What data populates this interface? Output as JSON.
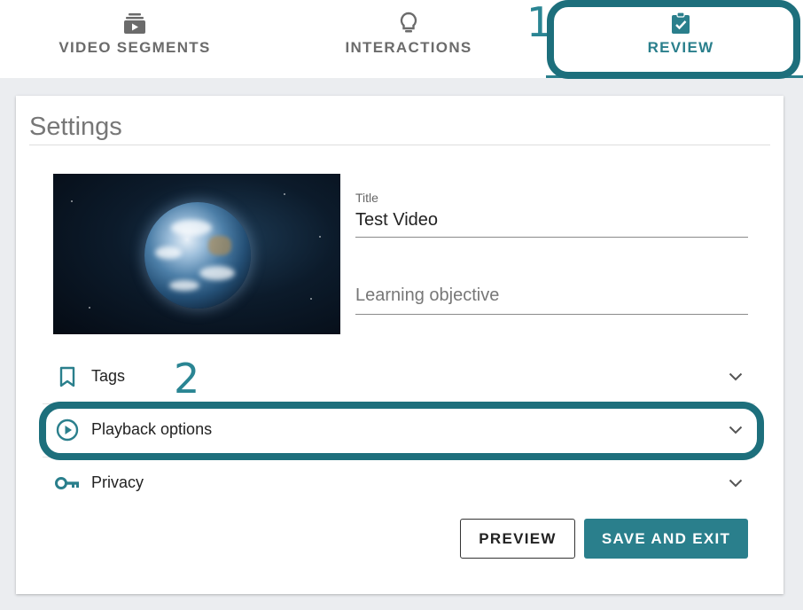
{
  "tabs": [
    {
      "label": "VIDEO SEGMENTS",
      "icon": "video-stack-icon"
    },
    {
      "label": "INTERACTIONS",
      "icon": "lightbulb-icon"
    },
    {
      "label": "REVIEW",
      "icon": "clipboard-check-icon",
      "active": true
    }
  ],
  "annotations": {
    "first": "1",
    "second": "2"
  },
  "settings": {
    "title": "Settings",
    "thumbnail_icon": "earth-video-thumbnail",
    "title_field": {
      "label": "Title",
      "value": "Test Video"
    },
    "objective_field": {
      "placeholder": "Learning objective"
    },
    "sections": [
      {
        "label": "Tags",
        "icon": "bookmark-icon"
      },
      {
        "label": "Playback options",
        "icon": "play-circle-icon"
      },
      {
        "label": "Privacy",
        "icon": "key-icon"
      }
    ],
    "buttons": {
      "preview": "PREVIEW",
      "save_exit": "SAVE AND EXIT"
    }
  },
  "colors": {
    "accent": "#2a7f8c",
    "annotation": "#1d6f7c",
    "background": "#ebedf0"
  }
}
